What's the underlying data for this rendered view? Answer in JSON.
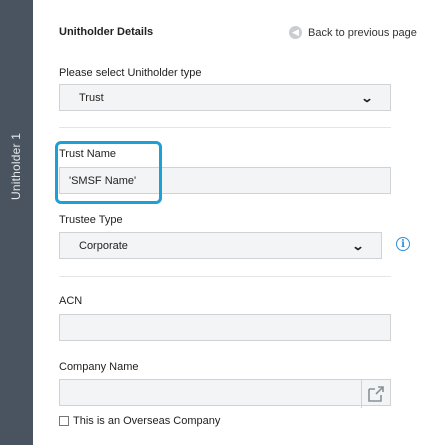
{
  "sidebar": {
    "tab_label": "Unitholder 1"
  },
  "header": {
    "title": "Unitholder Details",
    "back_label": "Back to previous page"
  },
  "unitholder_type": {
    "label": "Please select Unitholder type",
    "value": "Trust"
  },
  "trust_name": {
    "label": "Trust Name",
    "value": "'SMSF Name'"
  },
  "trustee_type": {
    "label": "Trustee Type",
    "value": "Corporate"
  },
  "acn": {
    "label": "ACN",
    "value": ""
  },
  "company_name": {
    "label": "Company Name",
    "value": ""
  },
  "overseas": {
    "label": "This is an Overseas Company",
    "checked": false
  },
  "colors": {
    "sidebar": "#4a5360",
    "highlight": "#1ca0d6",
    "info": "#2f90d5"
  }
}
